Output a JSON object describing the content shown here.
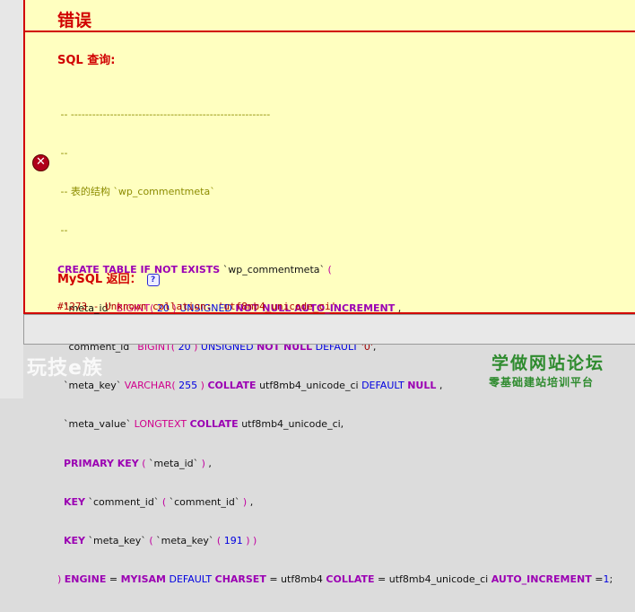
{
  "error": {
    "title": "错误",
    "sql_label": "SQL 查询:",
    "mysql_label": "MySQL 返回：",
    "help_glyph": "?",
    "error_message": "#1273 - Unknown collation: 'utf8mb4_unicode_ci'"
  },
  "code_lines": [
    " -- --------------------------------------------------------",
    " --",
    " -- 表的结构 `wp_commentmeta`",
    " --",
    "CREATE TABLE IF NOT EXISTS `wp_commentmeta` (",
    "  `meta_id` BIGINT( 20 ) UNSIGNED NOT NULL AUTO_INCREMENT ,",
    "  `comment_id` BIGINT( 20 ) UNSIGNED NOT NULL DEFAULT '0',",
    "  `meta_key` VARCHAR( 255 ) COLLATE utf8mb4_unicode_ci DEFAULT NULL ,",
    "  `meta_value` LONGTEXT COLLATE utf8mb4_unicode_ci,",
    "  PRIMARY KEY ( `meta_id` ) ,",
    "  KEY `comment_id` ( `comment_id` ) ,",
    "  KEY `meta_key` ( `meta_key` ( 191 ) )",
    ") ENGINE = MYISAM DEFAULT CHARSET = utf8mb4 COLLATE = utf8mb4_unicode_ci AUTO_INCREMENT =1;"
  ],
  "watermark": {
    "left": "玩技e族",
    "right_title": "学做网站论坛",
    "right_sub": "零基础建站培训平台"
  },
  "colors": {
    "error_red": "#d10000",
    "panel_yellow": "#ffffc0",
    "keyword_purple": "#9b00b3",
    "number_blue": "#0000e0",
    "watermark_green": "#2e8b2e"
  },
  "icons": {
    "error": "error-x-icon",
    "help": "help-icon"
  }
}
